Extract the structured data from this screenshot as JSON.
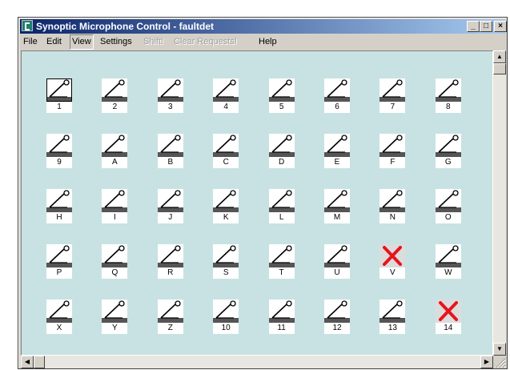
{
  "window": {
    "title": "Synoptic Microphone Control - faultdet",
    "minimize": "_",
    "maximize": "□",
    "close": "×"
  },
  "menu": [
    {
      "label": "File",
      "enabled": true,
      "active": false
    },
    {
      "label": "Edit",
      "enabled": true,
      "active": false
    },
    {
      "label": "View",
      "enabled": true,
      "active": true
    },
    {
      "label": "Settings",
      "enabled": true,
      "active": false
    },
    {
      "label": "Shift!",
      "enabled": false,
      "active": false
    },
    {
      "label": "Clear Requests!",
      "enabled": false,
      "active": false
    },
    {
      "label": "Help",
      "enabled": true,
      "active": false
    }
  ],
  "microphones": [
    {
      "label": "1",
      "status": "ok",
      "selected": true
    },
    {
      "label": "2",
      "status": "ok"
    },
    {
      "label": "3",
      "status": "ok"
    },
    {
      "label": "4",
      "status": "ok"
    },
    {
      "label": "5",
      "status": "ok"
    },
    {
      "label": "6",
      "status": "ok"
    },
    {
      "label": "7",
      "status": "ok"
    },
    {
      "label": "8",
      "status": "ok"
    },
    {
      "label": "9",
      "status": "ok"
    },
    {
      "label": "A",
      "status": "ok"
    },
    {
      "label": "B",
      "status": "ok"
    },
    {
      "label": "C",
      "status": "ok"
    },
    {
      "label": "D",
      "status": "ok"
    },
    {
      "label": "E",
      "status": "ok"
    },
    {
      "label": "F",
      "status": "ok"
    },
    {
      "label": "G",
      "status": "ok"
    },
    {
      "label": "H",
      "status": "ok"
    },
    {
      "label": "I",
      "status": "ok"
    },
    {
      "label": "J",
      "status": "ok"
    },
    {
      "label": "K",
      "status": "ok"
    },
    {
      "label": "L",
      "status": "ok"
    },
    {
      "label": "M",
      "status": "ok"
    },
    {
      "label": "N",
      "status": "ok"
    },
    {
      "label": "O",
      "status": "ok"
    },
    {
      "label": "P",
      "status": "ok"
    },
    {
      "label": "Q",
      "status": "ok"
    },
    {
      "label": "R",
      "status": "ok"
    },
    {
      "label": "S",
      "status": "ok"
    },
    {
      "label": "T",
      "status": "ok"
    },
    {
      "label": "U",
      "status": "ok"
    },
    {
      "label": "V",
      "status": "fault"
    },
    {
      "label": "W",
      "status": "ok"
    },
    {
      "label": "X",
      "status": "ok"
    },
    {
      "label": "Y",
      "status": "ok"
    },
    {
      "label": "Z",
      "status": "ok"
    },
    {
      "label": "10",
      "status": "ok"
    },
    {
      "label": "11",
      "status": "ok"
    },
    {
      "label": "12",
      "status": "ok"
    },
    {
      "label": "13",
      "status": "ok"
    },
    {
      "label": "14",
      "status": "fault"
    }
  ],
  "colors": {
    "fault_mark": "#e8141c",
    "canvas": "#c8e2e3",
    "title_start": "#0a246a",
    "title_end": "#a6caf0"
  }
}
